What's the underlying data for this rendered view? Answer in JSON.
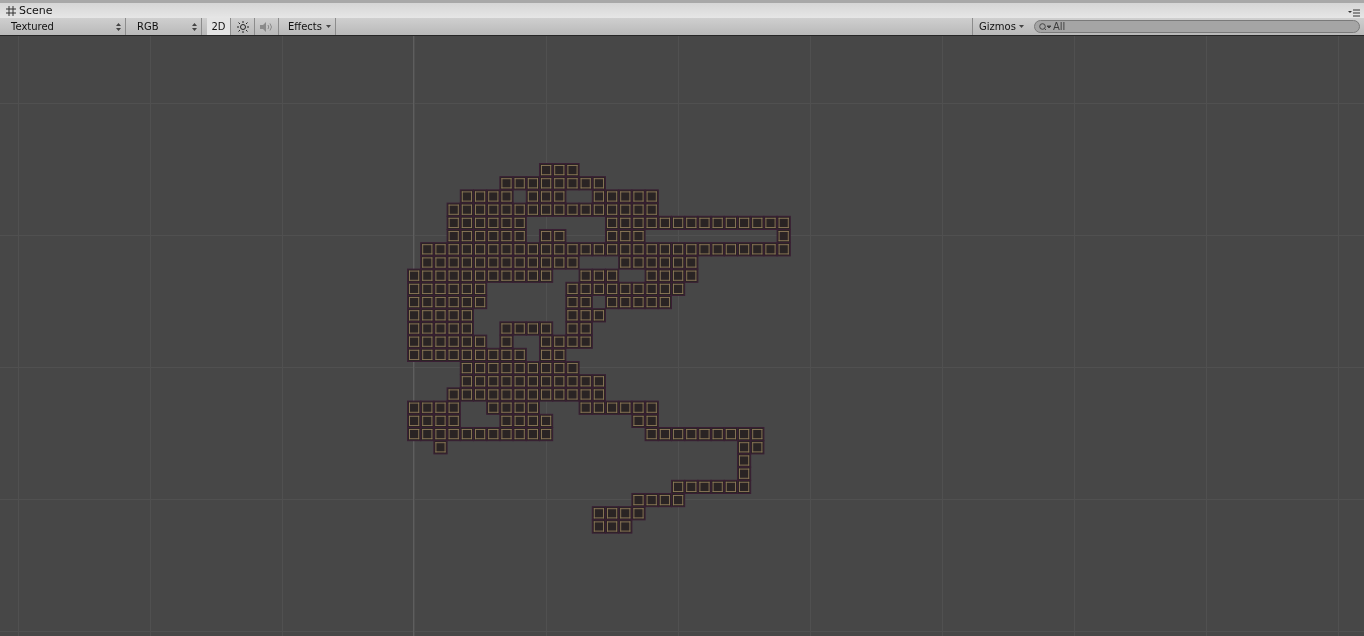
{
  "tab": {
    "title": "Scene"
  },
  "toolbar": {
    "draw_mode": "Textured",
    "render_mode": "RGB",
    "mode_2d": {
      "label": "2D",
      "on": true
    },
    "audio": {
      "disabled": true
    },
    "effects": "Effects",
    "gizmos": "Gizmos",
    "search": {
      "placeholder": "All"
    }
  }
}
